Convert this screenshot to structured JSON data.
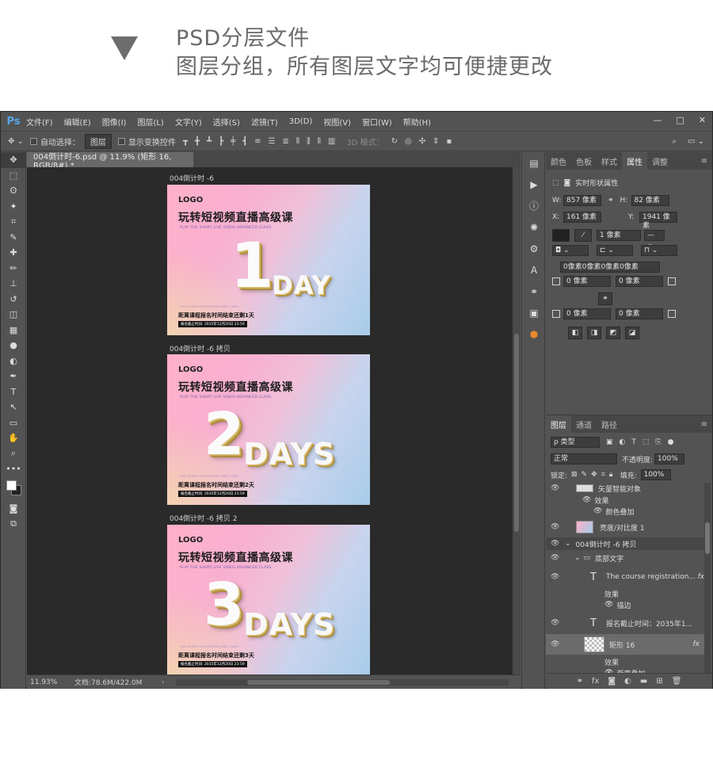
{
  "banner": {
    "line1": "PSD分层文件",
    "line2": "图层分组，所有图层文字均可便捷更改"
  },
  "app": {
    "logo": "Ps",
    "menu": [
      "文件(F)",
      "编辑(E)",
      "图像(I)",
      "图层(L)",
      "文字(Y)",
      "选择(S)",
      "滤镜(T)",
      "3D(D)",
      "视图(V)",
      "窗口(W)",
      "帮助(H)"
    ],
    "window_buttons": [
      "—",
      "□",
      "✕"
    ]
  },
  "options": {
    "auto_select_label": "自动选择：",
    "auto_select_value": "图层",
    "show_transform_label": "显示变换控件",
    "mode_label": "3D 模式："
  },
  "document": {
    "tab_title": "004倒计时-6.psd @ 11.9% (矩形 16, RGB/8#) *",
    "zoom": "11.93%",
    "doc_size": "文档:78.6M/422.0M"
  },
  "artboards": [
    {
      "label": "004倒计时 -6",
      "logo": "LOGO",
      "headline": "玩转短视频直播高级课",
      "sub": "PLAY THE SHORT LIVE VIDEO ADVANCED CLASS",
      "number": "1",
      "unit": "DAY",
      "tiny": "THE COURSE REGISTRATION ENDS 1 DAYS",
      "count_prefix": "距离课程报名时间结束",
      "count_strong": "还剩1天",
      "deadline": "报名截止时间: 2035年12月20日 23:59"
    },
    {
      "label": "004倒计时 -6 拷贝",
      "logo": "LOGO",
      "headline": "玩转短视频直播高级课",
      "sub": "PLAY THE SHORT LIVE VIDEO ADVANCED CLASS",
      "number": "2",
      "unit": "DAYS",
      "tiny": "THE COURSE REGISTRATION ENDS 2 DAYS",
      "count_prefix": "距离课程报名时间结束",
      "count_strong": "还剩2天",
      "deadline": "报名截止时间: 2035年12月20日 23:59"
    },
    {
      "label": "004倒计时 -6 拷贝 2",
      "logo": "LOGO",
      "headline": "玩转短视频直播高级课",
      "sub": "PLAY THE SHORT LIVE VIDEO ADVANCED CLASS",
      "number": "3",
      "unit": "DAYS",
      "tiny": "THE COURSE REGISTRATION ENDS 3 DAYS",
      "count_prefix": "距离课程报名时间结束",
      "count_strong": "还剩3天",
      "deadline": "报名截止时间: 2035年12月20日 23:59"
    }
  ],
  "panels": {
    "top_tabs": [
      "颜色",
      "色板",
      "样式",
      "属性",
      "调整"
    ],
    "active_top_tab": "属性",
    "properties": {
      "title": "实时形状属性",
      "w_label": "W:",
      "w_value": "857 像素",
      "h_label": "H:",
      "h_value": "82 像素",
      "x_label": "X:",
      "x_value": "161 像素",
      "y_label": "Y:",
      "y_value": "1941 像素",
      "stroke_width": "1 像素",
      "corner_all": "0像素0像素0像素0像素",
      "corner_tl": "0 像素",
      "corner_tr": "0 像素",
      "corner_bl": "0 像素",
      "corner_br": "0 像素"
    },
    "layer_tabs": [
      "图层",
      "通道",
      "路径"
    ],
    "active_layer_tab": "图层",
    "filter_kind": "ρ 类型",
    "blend_mode": "正常",
    "opacity_label": "不透明度:",
    "opacity_value": "100%",
    "lock_label": "锁定:",
    "fill_label": "填充:",
    "fill_value": "100%",
    "layers": [
      {
        "name": "矢量智能对象",
        "kind": "smart"
      },
      {
        "name": "效果",
        "kind": "effect"
      },
      {
        "name": "颜色叠加",
        "kind": "effect-item"
      },
      {
        "name": "亮度/对比度 1",
        "kind": "adjust"
      },
      {
        "name": "004倒计时 -6 拷贝",
        "kind": "group"
      },
      {
        "name": "底部文字",
        "kind": "folder"
      },
      {
        "name": "The course registration...",
        "kind": "text"
      },
      {
        "name": "效果",
        "kind": "effect"
      },
      {
        "name": "描边",
        "kind": "effect-item"
      },
      {
        "name": "报名截止时间：2035年1...",
        "kind": "text"
      },
      {
        "name": "矩形 16",
        "kind": "shape"
      },
      {
        "name": "效果",
        "kind": "effect"
      },
      {
        "name": "渐变叠加",
        "kind": "effect-item"
      }
    ]
  },
  "icons": {
    "move": "✥",
    "marquee": "⬚",
    "lasso": "ʘ",
    "wand": "✦",
    "crop": "⌗",
    "eyedrop": "✎",
    "heal": "✚",
    "brush": "✏",
    "stamp": "⊥",
    "history": "↺",
    "eraser": "◫",
    "gradient": "▦",
    "blur": "●",
    "dodge": "◐",
    "pen": "✒",
    "type": "T",
    "path": "↖",
    "shape": "▭",
    "hand": "✋",
    "zoom": "⌕",
    "more": "•••"
  }
}
